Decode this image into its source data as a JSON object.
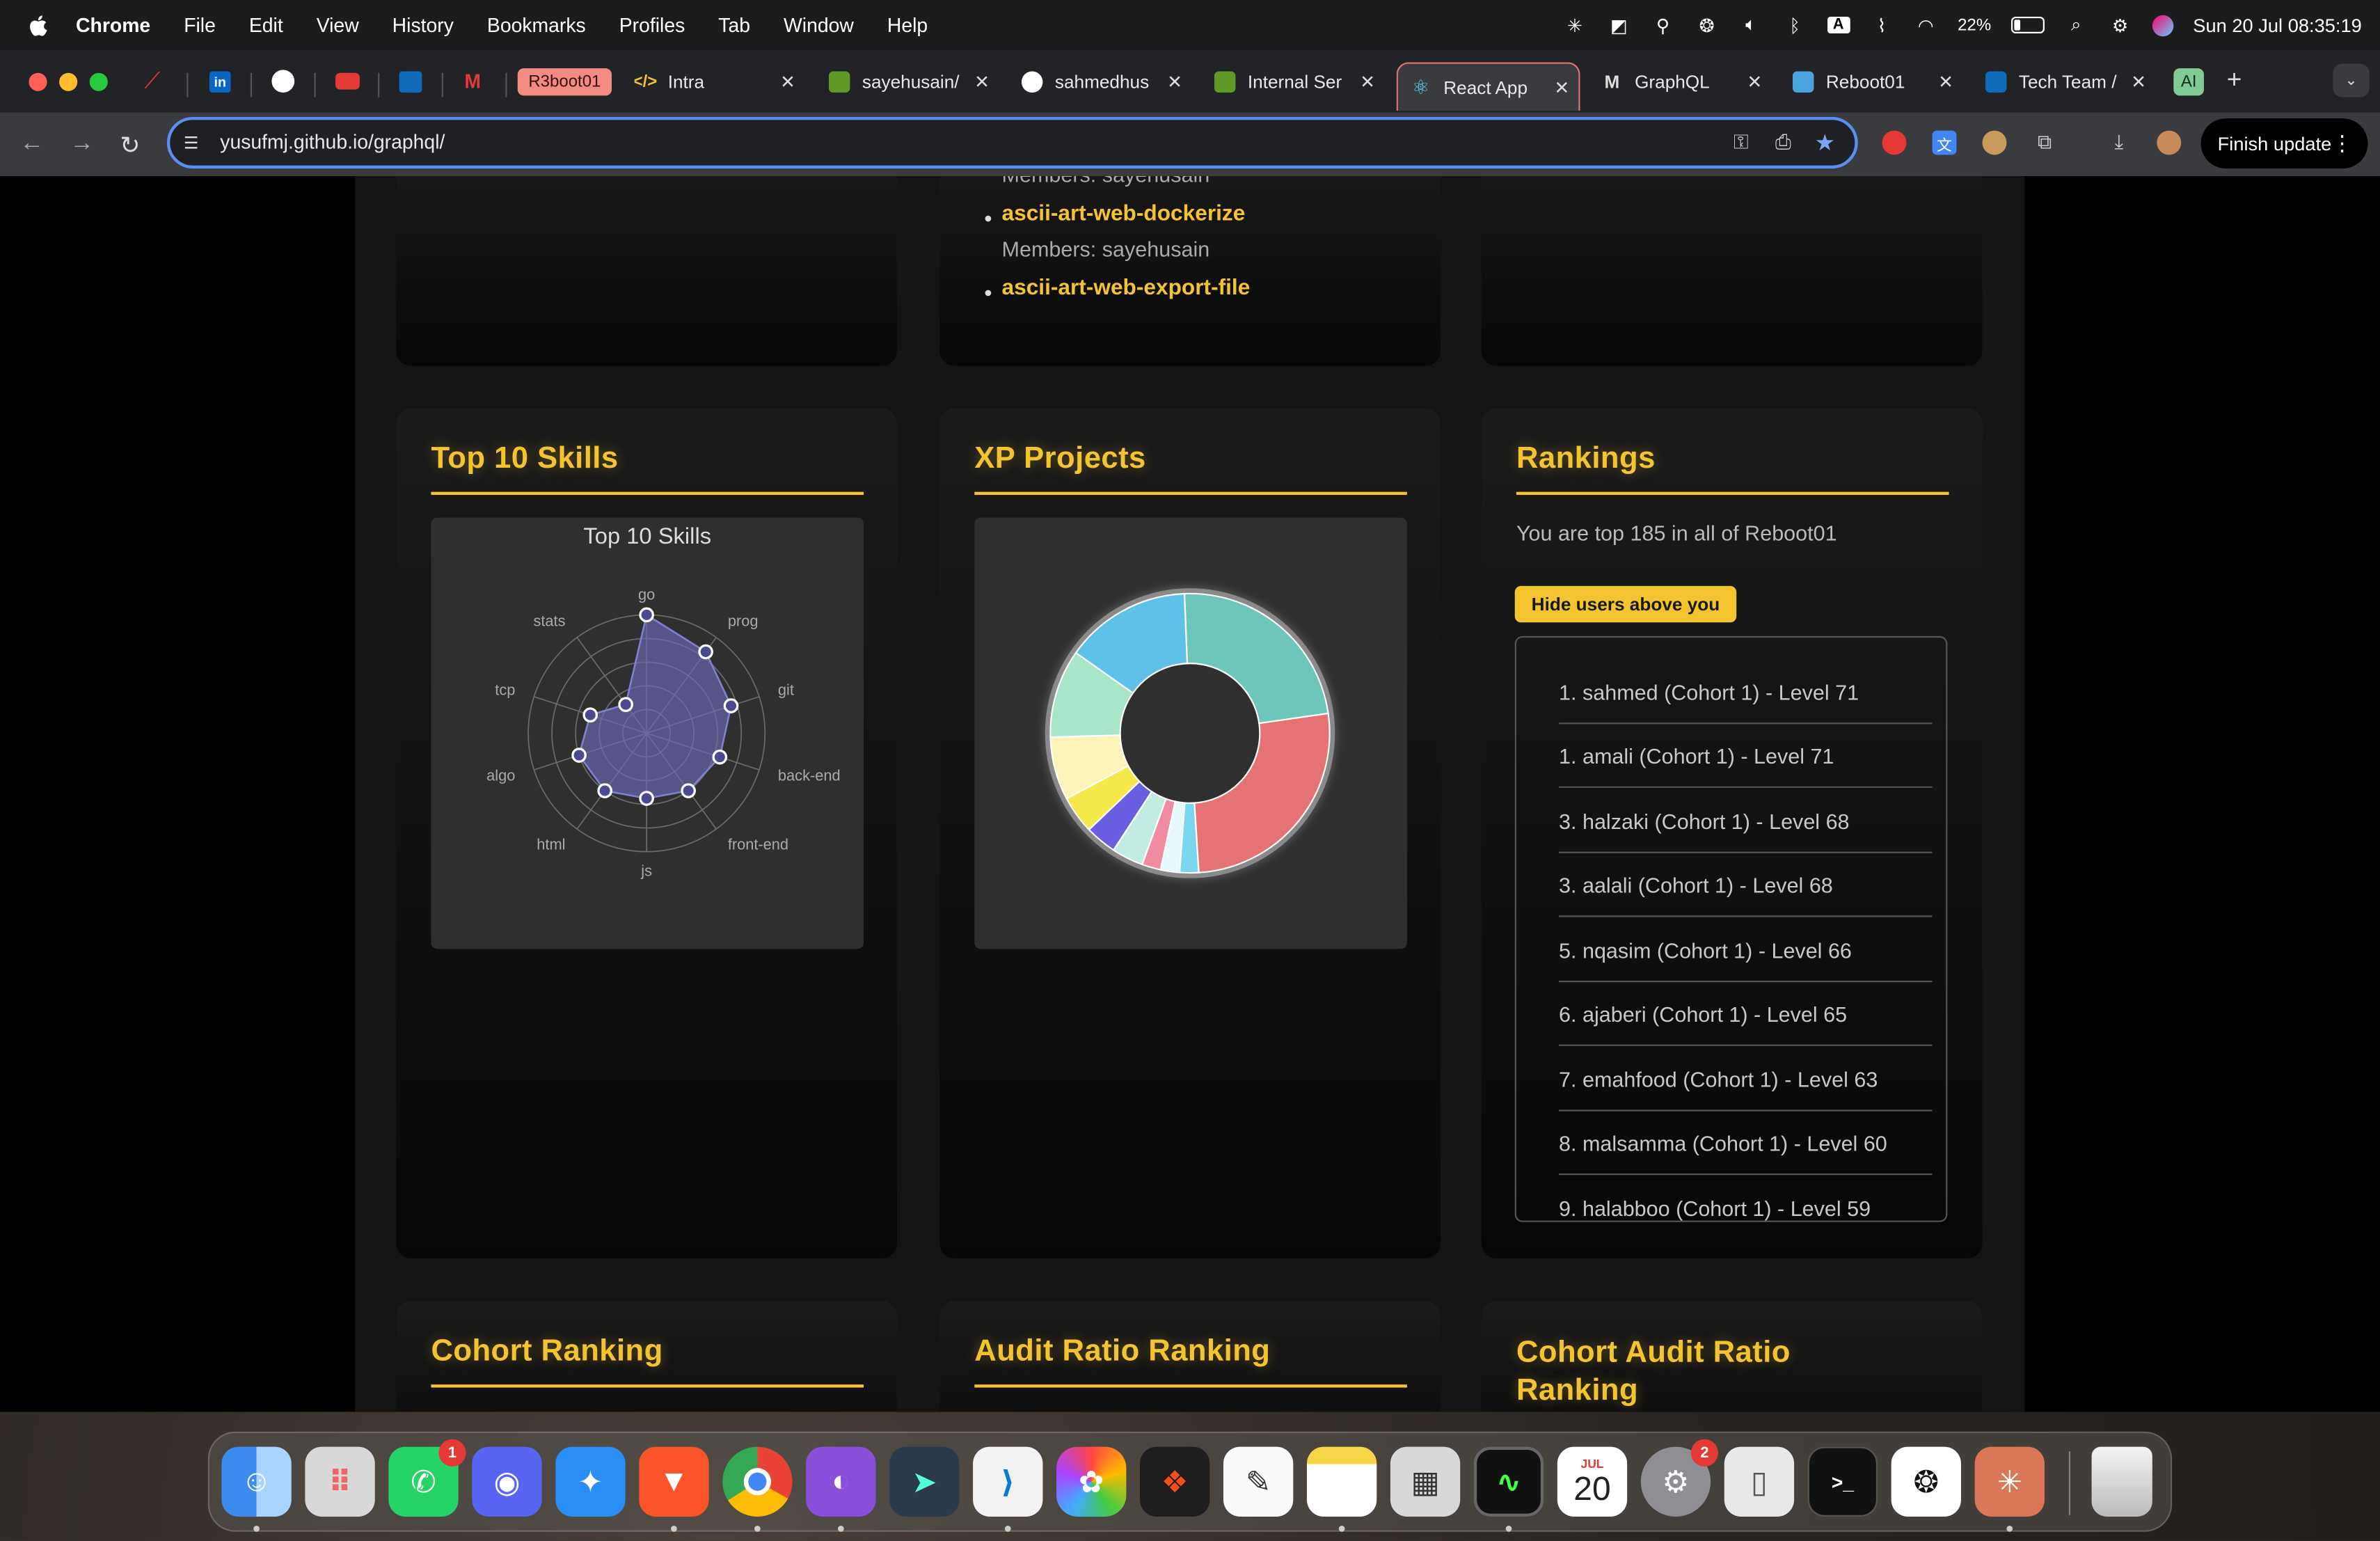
{
  "menubar": {
    "app": "Chrome",
    "items": [
      "File",
      "Edit",
      "View",
      "History",
      "Bookmarks",
      "Profiles",
      "Tab",
      "Window",
      "Help"
    ],
    "battery": "22%",
    "datetime": "Sun 20 Jul  08:35:19",
    "input_source": "A"
  },
  "tabs": [
    {
      "label": "R3boot01",
      "kind": "group"
    },
    {
      "label": "Intra"
    },
    {
      "label": "sayehusain/"
    },
    {
      "label": "sahmedhus"
    },
    {
      "label": "Internal Ser"
    },
    {
      "label": "React App",
      "active": true
    },
    {
      "label": "GraphQL"
    },
    {
      "label": "Reboot01"
    },
    {
      "label": "Tech Team /"
    },
    {
      "label": "AI",
      "kind": "group"
    }
  ],
  "toolbar": {
    "url": "yusufmj.github.io/graphql/",
    "finish_update": "Finish update"
  },
  "projects_partial": {
    "members_cut": "Members: sayehusain",
    "items": [
      {
        "title": "ascii-art-web-dockerize",
        "members": "Members: sayehusain"
      },
      {
        "title": "ascii-art-web-export-file"
      }
    ]
  },
  "skills": {
    "title": "Top 10 Skills",
    "chart_title": "Top 10 Skills",
    "chart_data": {
      "type": "radar",
      "categories": [
        "go",
        "prog",
        "git",
        "back-end",
        "front-end",
        "js",
        "html",
        "algo",
        "tcp",
        "stats"
      ],
      "values": [
        100,
        85,
        75,
        65,
        60,
        55,
        60,
        60,
        50,
        30
      ],
      "max": 100,
      "color": "#6a6ab8"
    }
  },
  "xp": {
    "title": "XP Projects",
    "chart_data": {
      "type": "pie",
      "donut": true,
      "values": [
        36,
        32,
        20,
        14,
        10,
        6,
        5,
        5,
        3,
        3,
        3
      ],
      "colors": [
        "#e57373",
        "#6ec6ba",
        "#5dc1e8",
        "#a8e6c8",
        "#fbf3b8",
        "#f5e84a",
        "#6860e0",
        "#c0ece4",
        "#f08ca0",
        "#e8f8ff",
        "#7ad6ee"
      ]
    }
  },
  "rankings": {
    "title": "Rankings",
    "summary": "You are top 185 in all of Reboot01",
    "button": "Hide users above you",
    "items": [
      "1. sahmed (Cohort 1) - Level 71",
      "1. amali (Cohort 1) - Level 71",
      "3. halzaki (Cohort 1) - Level 68",
      "3. aalali (Cohort 1) - Level 68",
      "5. nqasim (Cohort 1) - Level 66",
      "6. ajaberi (Cohort 1) - Level 65",
      "7. emahfood (Cohort 1) - Level 63",
      "8. malsamma (Cohort 1) - Level 60",
      "9. halabboo (Cohort 1) - Level 59"
    ]
  },
  "bottom_cards": [
    "Cohort Ranking",
    "Audit Ratio Ranking",
    "Cohort Audit Ratio Ranking"
  ],
  "dock": {
    "badges": {
      "whatsapp": "1",
      "settings": "2"
    },
    "calendar_month": "JUL",
    "calendar_day": "20"
  }
}
